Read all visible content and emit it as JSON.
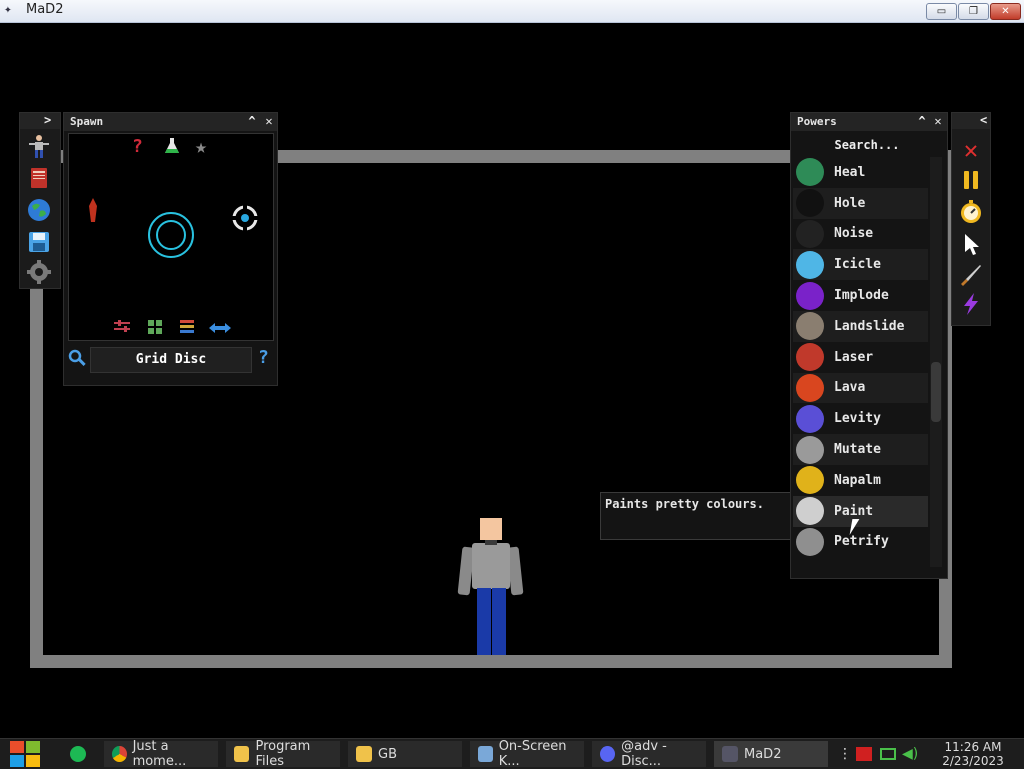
{
  "window": {
    "title": "MaD2",
    "minimize": "▭",
    "restore": "❐",
    "close": "✕"
  },
  "spawn": {
    "title": "Spawn",
    "selected_item": "Grid Disc",
    "top_icons": [
      "question-icon",
      "flask-icon",
      "star-icon"
    ],
    "bottom_icons": [
      "sliders-icon",
      "grid-icon",
      "list-icon",
      "arrows-icon"
    ]
  },
  "left_rail": {
    "items": [
      "ragdoll-icon",
      "book-icon",
      "globe-icon",
      "save-icon",
      "gear-icon"
    ]
  },
  "powers": {
    "title": "Powers",
    "search_placeholder": "Search...",
    "items": [
      {
        "label": "Heal",
        "color": "#2e8b57"
      },
      {
        "label": "Hole",
        "color": "#111111"
      },
      {
        "label": "Noise",
        "color": "#222222"
      },
      {
        "label": "Icicle",
        "color": "#4fb6e6"
      },
      {
        "label": "Implode",
        "color": "#7a22c9"
      },
      {
        "label": "Landslide",
        "color": "#8a7e70"
      },
      {
        "label": "Laser",
        "color": "#c0392b"
      },
      {
        "label": "Lava",
        "color": "#d9461f"
      },
      {
        "label": "Levity",
        "color": "#5a4fd6"
      },
      {
        "label": "Mutate",
        "color": "#9a9a9a"
      },
      {
        "label": "Napalm",
        "color": "#e0b21a"
      },
      {
        "label": "Paint",
        "color": "#cfcfcf"
      },
      {
        "label": "Petrify",
        "color": "#8f8f8f"
      }
    ]
  },
  "right_rail": {
    "items": [
      "close-red-icon",
      "pause-icon",
      "stopwatch-icon",
      "pointer-icon",
      "knife-icon",
      "lightning-icon"
    ]
  },
  "tooltip": {
    "text": "Paints pretty colours."
  },
  "taskbar": {
    "tasks": [
      {
        "label": "Just a mome...",
        "icon": "chrome-icon"
      },
      {
        "label": "Program Files",
        "icon": "folder-icon"
      },
      {
        "label": "GB",
        "icon": "folder-icon"
      },
      {
        "label": "On-Screen K...",
        "icon": "keyboard-icon"
      },
      {
        "label": "@adv - Disc...",
        "icon": "discord-icon"
      },
      {
        "label": "MaD2",
        "icon": "mad2-icon"
      }
    ],
    "time": "11:26 AM",
    "date": "2/23/2023"
  }
}
